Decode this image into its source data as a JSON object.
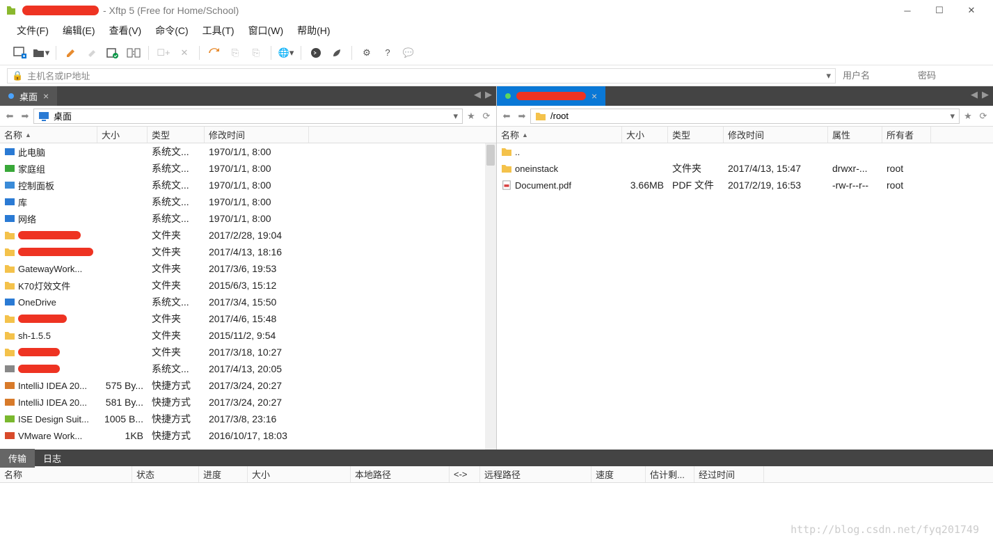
{
  "title": " - Xftp 5 (Free for Home/School)",
  "menu": [
    "文件(F)",
    "编辑(E)",
    "查看(V)",
    "命令(C)",
    "工具(T)",
    "窗口(W)",
    "帮助(H)"
  ],
  "address": {
    "placeholder": "主机名或IP地址",
    "user_ph": "用户名",
    "pass_ph": "密码"
  },
  "local": {
    "tab": "桌面",
    "path": "桌面",
    "headers": {
      "name": "名称",
      "size": "大小",
      "type": "类型",
      "date": "修改时间"
    },
    "rows": [
      {
        "icon": "pc",
        "name": "此电脑",
        "size": "",
        "type": "系统文...",
        "date": "1970/1/1, 8:00"
      },
      {
        "icon": "home",
        "name": "家庭组",
        "size": "",
        "type": "系统文...",
        "date": "1970/1/1, 8:00"
      },
      {
        "icon": "panel",
        "name": "控制面板",
        "size": "",
        "type": "系统文...",
        "date": "1970/1/1, 8:00"
      },
      {
        "icon": "lib",
        "name": "库",
        "size": "",
        "type": "系统文...",
        "date": "1970/1/1, 8:00"
      },
      {
        "icon": "net",
        "name": "网络",
        "size": "",
        "type": "系统文...",
        "date": "1970/1/1, 8:00"
      },
      {
        "icon": "folder",
        "redact": 90,
        "size": "",
        "type": "文件夹",
        "date": "2017/2/28, 19:04"
      },
      {
        "icon": "folder",
        "redact": 110,
        "size": "",
        "type": "文件夹",
        "date": "2017/4/13, 18:16"
      },
      {
        "icon": "folder",
        "name": "GatewayWork...",
        "size": "",
        "type": "文件夹",
        "date": "2017/3/6, 19:53"
      },
      {
        "icon": "folder",
        "name": "K70灯效文件",
        "size": "",
        "type": "文件夹",
        "date": "2015/6/3, 15:12"
      },
      {
        "icon": "cloud",
        "name": "OneDrive",
        "size": "",
        "type": "系统文...",
        "date": "2017/3/4, 15:50"
      },
      {
        "icon": "folder",
        "redact": 70,
        "size": "",
        "type": "文件夹",
        "date": "2017/4/6, 15:48"
      },
      {
        "icon": "folder",
        "name": "sh-1.5.5",
        "size": "",
        "type": "文件夹",
        "date": "2015/11/2, 9:54"
      },
      {
        "icon": "folder",
        "redact": 60,
        "size": "",
        "type": "文件夹",
        "date": "2017/3/18, 10:27"
      },
      {
        "icon": "sys",
        "redact": 60,
        "size": "",
        "type": "系统文...",
        "date": "2017/4/13, 20:05"
      },
      {
        "icon": "app",
        "name": "IntelliJ IDEA 20...",
        "size": "575 By...",
        "type": "快捷方式",
        "date": "2017/3/24, 20:27"
      },
      {
        "icon": "app",
        "name": "IntelliJ IDEA 20...",
        "size": "581 By...",
        "type": "快捷方式",
        "date": "2017/3/24, 20:27"
      },
      {
        "icon": "app2",
        "name": "ISE Design Suit...",
        "size": "1005 B...",
        "type": "快捷方式",
        "date": "2017/3/8, 23:16"
      },
      {
        "icon": "app3",
        "name": "VMware Work...",
        "size": "1KB",
        "type": "快捷方式",
        "date": "2016/10/17, 18:03"
      }
    ]
  },
  "remote": {
    "path": "/root",
    "headers": {
      "name": "名称",
      "size": "大小",
      "type": "类型",
      "date": "修改时间",
      "attr": "属性",
      "owner": "所有者"
    },
    "rows": [
      {
        "icon": "folder",
        "name": "..",
        "size": "",
        "type": "",
        "date": "",
        "attr": "",
        "owner": ""
      },
      {
        "icon": "folder",
        "name": "oneinstack",
        "size": "",
        "type": "文件夹",
        "date": "2017/4/13, 15:47",
        "attr": "drwxr-...",
        "owner": "root"
      },
      {
        "icon": "pdf",
        "name": "Document.pdf",
        "size": "3.66MB",
        "type": "PDF 文件",
        "date": "2017/2/19, 16:53",
        "attr": "-rw-r--r--",
        "owner": "root"
      }
    ]
  },
  "bottom_tabs": [
    "传输",
    "日志"
  ],
  "transfer_headers": {
    "name": "名称",
    "status": "状态",
    "prog": "进度",
    "size": "大小",
    "lpath": "本地路径",
    "dir": "<->",
    "rpath": "远程路径",
    "speed": "速度",
    "eta": "估计剩...",
    "elapsed": "经过时间"
  },
  "watermark": "http://blog.csdn.net/fyq201749"
}
